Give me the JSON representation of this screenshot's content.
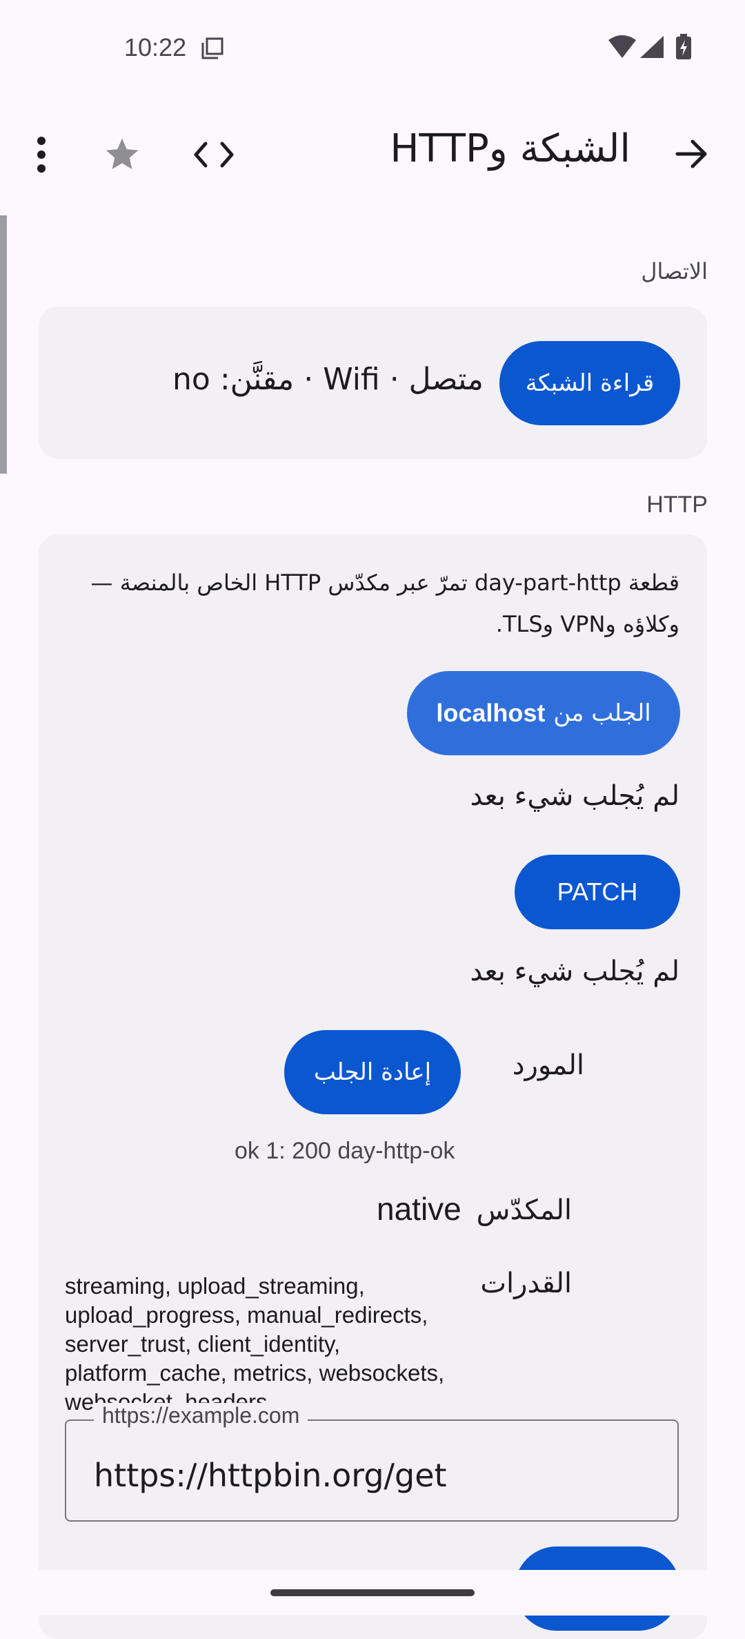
{
  "status_bar": {
    "time": "10:22"
  },
  "topbar": {
    "title": "الشبكة وHTTP"
  },
  "connection": {
    "section_label": "الاتصال",
    "read_button": "قراءة الشبكة",
    "status_text": "متصل · Wifi · مقنَّن: no"
  },
  "http": {
    "section_label": "HTTP",
    "description": "قطعة day-part-http تمرّ عبر مكدّس HTTP الخاص بالمنصة — وكلاؤه وVPN وTLS.",
    "fetch_localhost_prefix": "الجلب من",
    "fetch_localhost_host": "localhost",
    "fetch_localhost_result": "لم يُجلب شيء بعد",
    "patch_button": "PATCH",
    "patch_result": "لم يُجلب شيء بعد",
    "resource_label": "المورد",
    "refetch_button": "إعادة الجلب",
    "resource_result": "ok 1: 200 day-http-ok",
    "stack_label": "المكدّس",
    "stack_value": "native",
    "capabilities_label": "القدرات",
    "capabilities_value": "streaming, upload_streaming, upload_progress, manual_redirects, server_trust, client_identity, platform_cache, metrics, websockets, websocket_headers",
    "url_field": {
      "label": "https://example.com",
      "value": "https://httpbin.org/get"
    }
  },
  "colors": {
    "primary": "#0b57d0",
    "primary_light": "#2f6fdc",
    "background": "#fcf8fd",
    "card": "#f2eff5"
  }
}
